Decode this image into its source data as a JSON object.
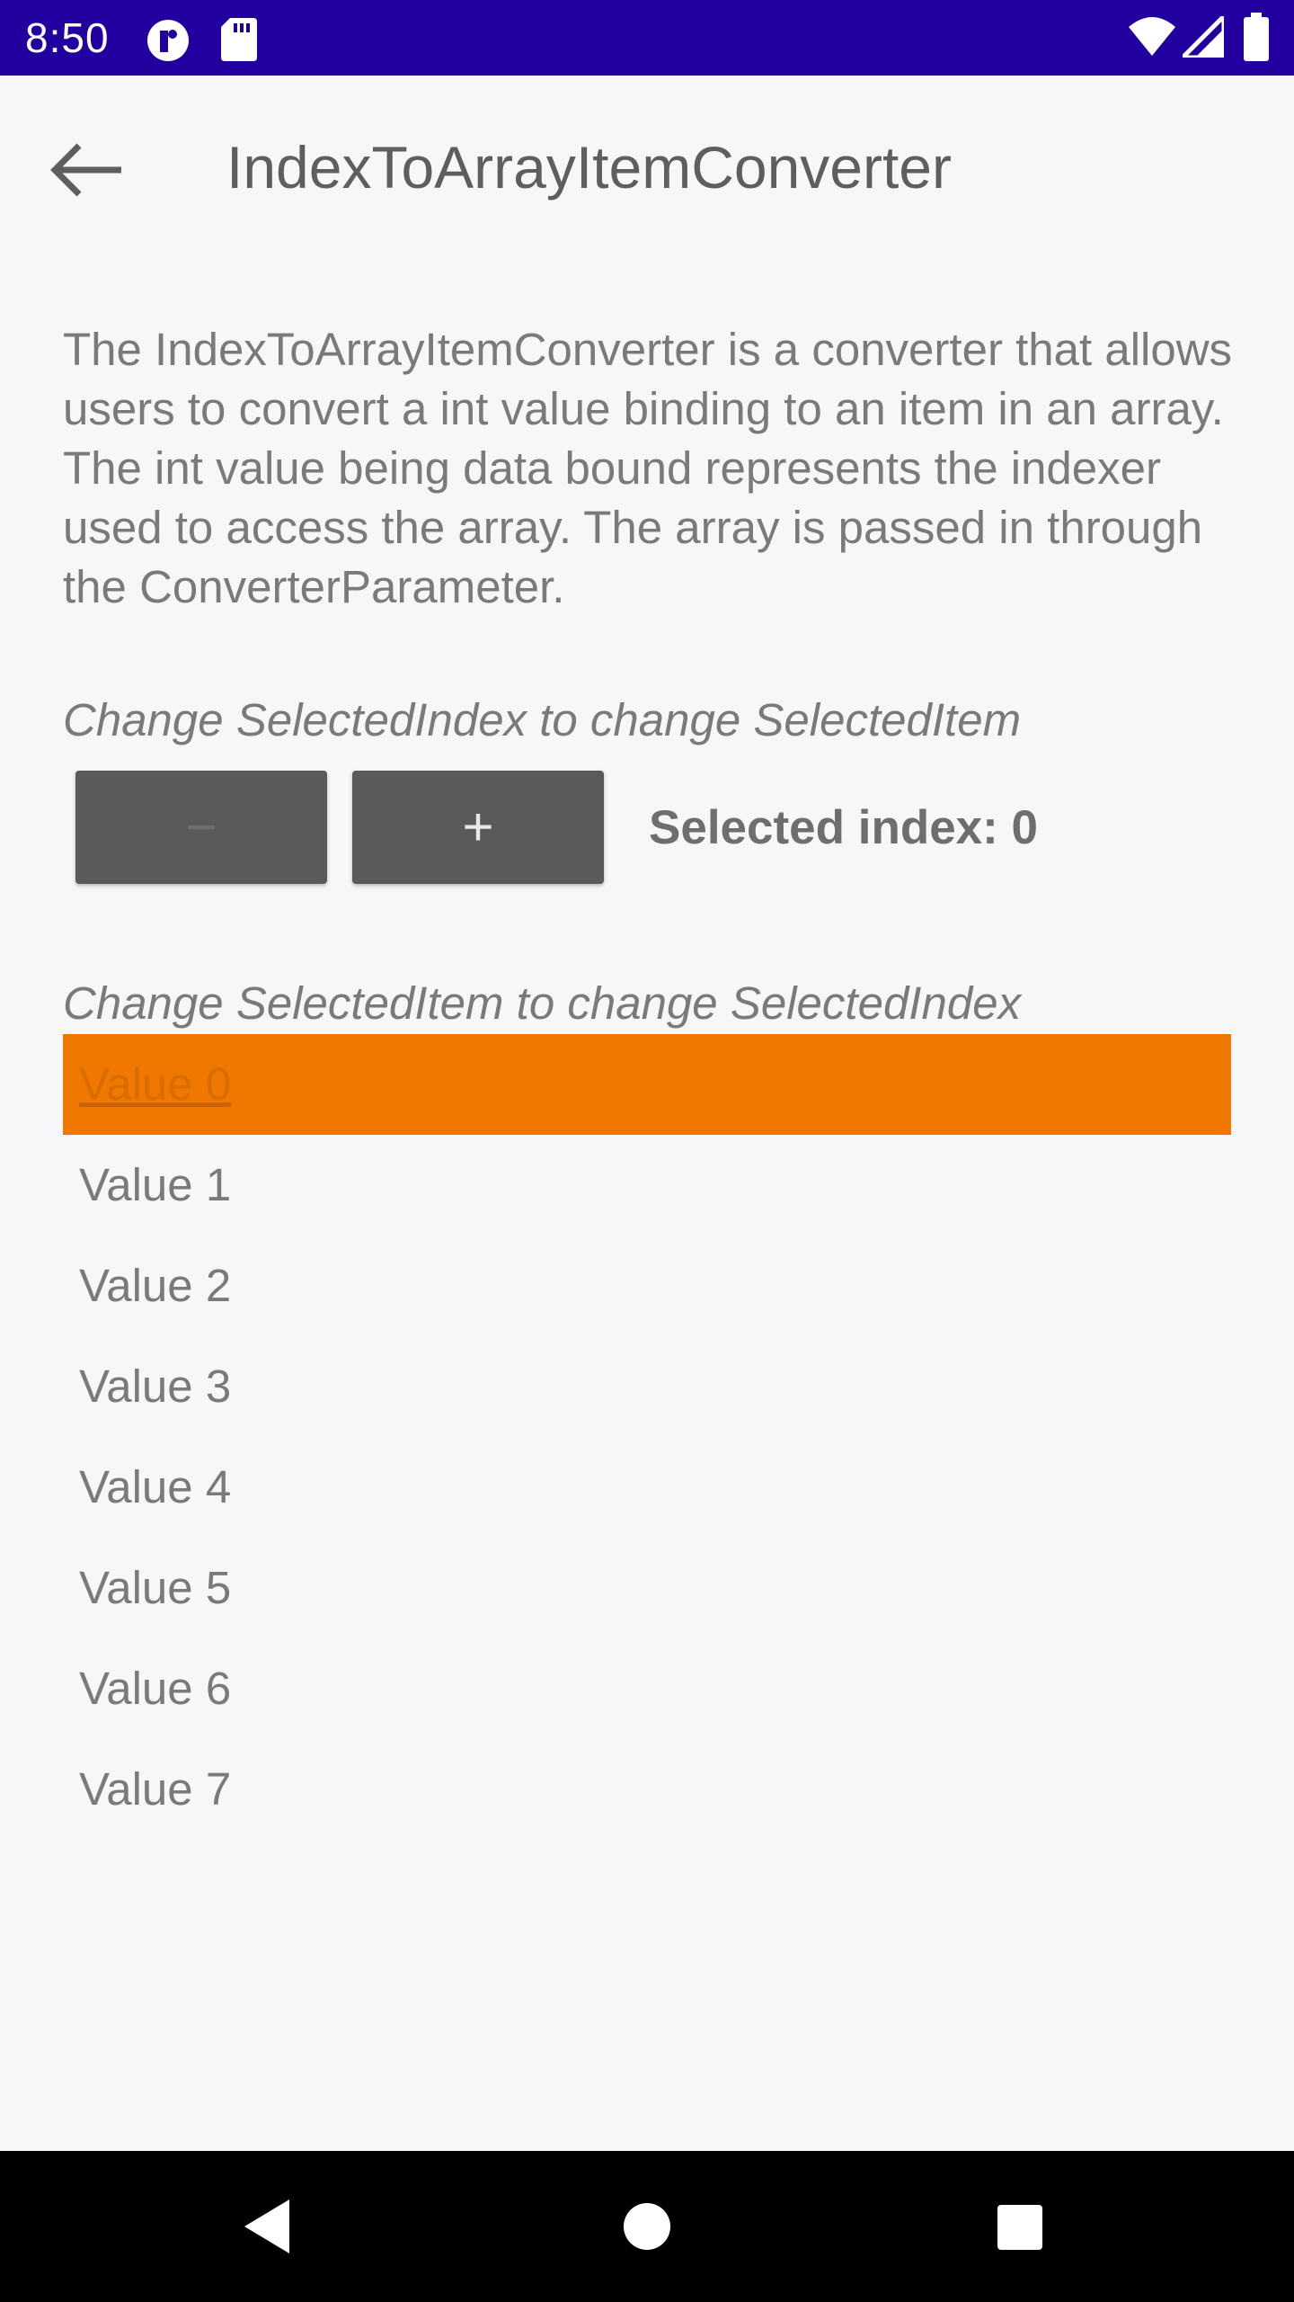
{
  "status_bar": {
    "time": "8:50",
    "background_color": "#2200a0",
    "left_icons": [
      "notification-app-icon",
      "sd-card-icon"
    ],
    "right_icons": [
      "wifi-icon",
      "cell-signal-icon",
      "battery-icon"
    ]
  },
  "app_bar": {
    "back_icon": "arrow-back-icon",
    "title": "IndexToArrayItemConverter"
  },
  "content": {
    "description": "The IndexToArrayItemConverter is a converter that allows users to convert a int value binding to an item in an array. The int value being data bound represents the indexer used to access the array. The array is passed in through the ConverterParameter.",
    "index_section_label": "Change SelectedIndex to change SelectedItem",
    "decrement_label": "−",
    "increment_label": "+",
    "selected_index_text": "Selected index: 0",
    "item_section_label": "Change SelectedItem to change SelectedIndex",
    "items": [
      {
        "label": "Value 0",
        "selected": true
      },
      {
        "label": "Value 1",
        "selected": false
      },
      {
        "label": "Value 2",
        "selected": false
      },
      {
        "label": "Value 3",
        "selected": false
      },
      {
        "label": "Value 4",
        "selected": false
      },
      {
        "label": "Value 5",
        "selected": false
      },
      {
        "label": "Value 6",
        "selected": false
      },
      {
        "label": "Value 7",
        "selected": false
      }
    ]
  },
  "colors": {
    "accent": "#f07800",
    "button": "#5a5a5a",
    "background": "#f7f7f9"
  },
  "nav_bar": {
    "icons": [
      "nav-back-icon",
      "nav-home-icon",
      "nav-recents-icon"
    ]
  }
}
